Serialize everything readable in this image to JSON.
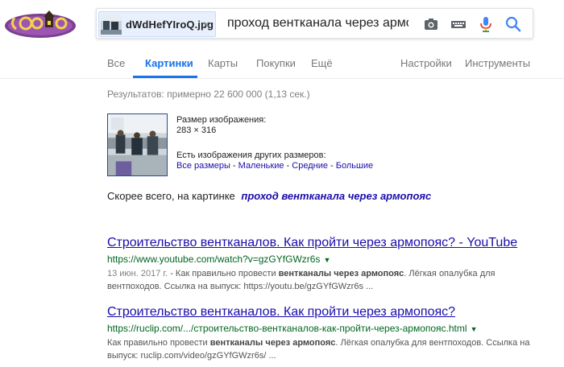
{
  "search": {
    "image_chip_name": "dWdHefYIroQ.jpg",
    "chip_close": "×",
    "query": "проход вентканала через армопояс"
  },
  "icons": [
    "google-doodle-logo",
    "camera-icon",
    "keyboard-icon",
    "microphone-icon",
    "search-icon"
  ],
  "nav": {
    "tabs": [
      "Все",
      "Картинки",
      "Карты",
      "Покупки",
      "Ещё"
    ],
    "active_tab": "Картинки",
    "right": [
      "Настройки",
      "Инструменты"
    ]
  },
  "results_count": "Результатов: примерно 22 600 000 (1,13 сек.)",
  "image_info": {
    "size_label": "Размер изображения:",
    "size_value": "283 × 316",
    "other_sizes_label": "Есть изображения других размеров:",
    "links": [
      "Все размеры",
      "Маленькие",
      "Средние",
      "Большие"
    ],
    "separator": " - "
  },
  "best_guess": {
    "label": "Скорее всего, на картинке",
    "query": "проход вентканала через армопояс"
  },
  "results": [
    {
      "title": "Строительство вентканалов. Как пройти через армопояс? - YouTube",
      "url": "https://www.youtube.com/watch?v=gzGYfGWzr6s",
      "caret": "▼",
      "date": "13 июн. 2017 г.",
      "snippet_1": " - Как правильно провести ",
      "snippet_bold": "вентканалы через армопояс",
      "snippet_2": ". Лёгкая опалубка для вентпоходов. Ссылка на выпуск: https://youtu.be/gzGYfGWzr6s ..."
    },
    {
      "title": "Строительство вентканалов. Как пройти через армопояс?",
      "url": "https://ruclip.com/.../строительство-вентканалов-как-пройти-через-армопояс.html",
      "caret": "▼",
      "snippet_1": "Как правильно провести ",
      "snippet_bold": "вентканалы через армопояс",
      "snippet_2": ". Лёгкая опалубка для вентпоходов. Ссылка на выпуск: ruclip.com/video/gzGYfGWzr6s/ ..."
    }
  ],
  "colors": {
    "link": "#1a0dab",
    "url": "#006621",
    "active_tab": "#1a73e8",
    "muted": "#808080"
  }
}
